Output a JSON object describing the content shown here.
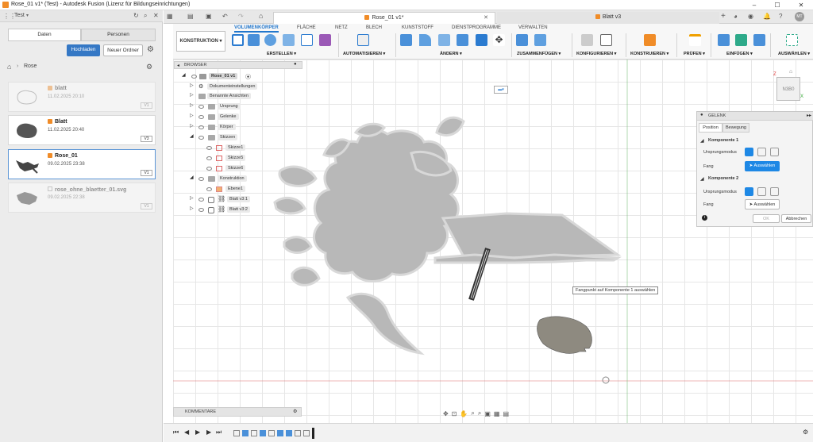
{
  "window": {
    "title": "Rose_01 v1* (Test) - Autodesk Fusion (Lizenz für Bildungseinrichtungen)"
  },
  "project": {
    "name": "Test"
  },
  "left_panel": {
    "tabs": [
      "Daten",
      "Personen"
    ],
    "upload_label": "Hochladen",
    "new_folder_label": "Neuer Ordner",
    "breadcrumb": "Rose",
    "files": [
      {
        "name": "blatt",
        "date": "11.02.2025 20:10",
        "version": "V1"
      },
      {
        "name": "Blatt",
        "date": "11.02.2025 20:40",
        "version": "V3"
      },
      {
        "name": "Rose_01",
        "date": "09.02.2025 23:38",
        "version": "V1"
      },
      {
        "name": "rose_ohne_blaetter_01.svg",
        "date": "09.02.2025 22:38",
        "version": "V1"
      }
    ]
  },
  "doc_tabs": [
    {
      "label": "Rose_01 v1*",
      "active": true
    },
    {
      "label": "Blatt v3",
      "active": false
    }
  ],
  "toolbar": {
    "workspace": "KONSTRUKTION",
    "tabs": [
      "VOLUMENKÖRPER",
      "FLÄCHE",
      "NETZ",
      "BLECH",
      "KUNSTSTOFF",
      "DIENSTPROGRAMME",
      "VERWALTEN"
    ],
    "groups": [
      "ERSTELLEN",
      "AUTOMATISIEREN",
      "ÄNDERN",
      "ZUSAMMENFÜGEN",
      "KONFIGURIEREN",
      "KONSTRUIEREN",
      "PRÜFEN",
      "EINFÜGEN",
      "AUSWÄHLEN"
    ]
  },
  "browser": {
    "title": "BROWSER",
    "root": "Rose_01 v1",
    "items": [
      "Dokumenteinstellungen",
      "Benannte Ansichten",
      "Ursprung",
      "Gelenke",
      "Körper",
      "Skizzen",
      "Skizze1",
      "Skizze5",
      "Skizze6",
      "Konstruktion",
      "Ebene1",
      "Blatt v3:1",
      "Blatt v3:2"
    ]
  },
  "joint_panel": {
    "title": "GELENK",
    "tabs": [
      "Position",
      "Bewegung"
    ],
    "component1": "Komponente 1",
    "component2": "Komponente 2",
    "origin_mode": "Ursprungsmodus",
    "snap": "Fang",
    "select_label": "Auswählen",
    "ok": "OK",
    "cancel": "Abbrechen"
  },
  "tooltip": "Fangpunkt auf Komponente 1 auswählen",
  "viewcube_label": "N3B0",
  "comments_label": "KOMMENTARE",
  "user_initials": "MT",
  "colors": {
    "accent": "#2277cc",
    "brand": "#f08c28",
    "selected_blue": "#1e88e5"
  }
}
